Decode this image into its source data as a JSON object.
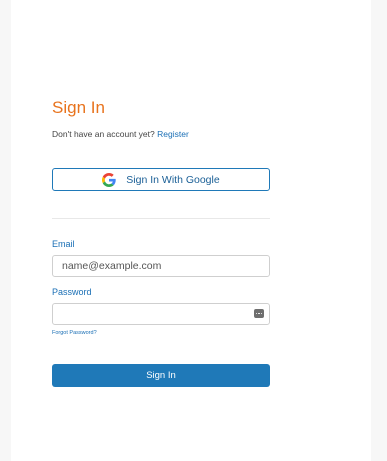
{
  "page": {
    "title": "Sign In",
    "register_prompt": "Don't have an account yet?",
    "register_link": "Register"
  },
  "google": {
    "label": "Sign In With Google",
    "icon": "google-g-icon"
  },
  "form": {
    "email_label": "Email",
    "email_placeholder": "name@example.com",
    "email_value": "",
    "password_label": "Password",
    "password_value": "",
    "password_manager_icon": "password-manager-icon",
    "forgot_link": "Forgot Password?",
    "submit_label": "Sign In"
  },
  "colors": {
    "title": "#e8731d",
    "primary": "#1f79b8",
    "link": "#1a6fb5"
  }
}
